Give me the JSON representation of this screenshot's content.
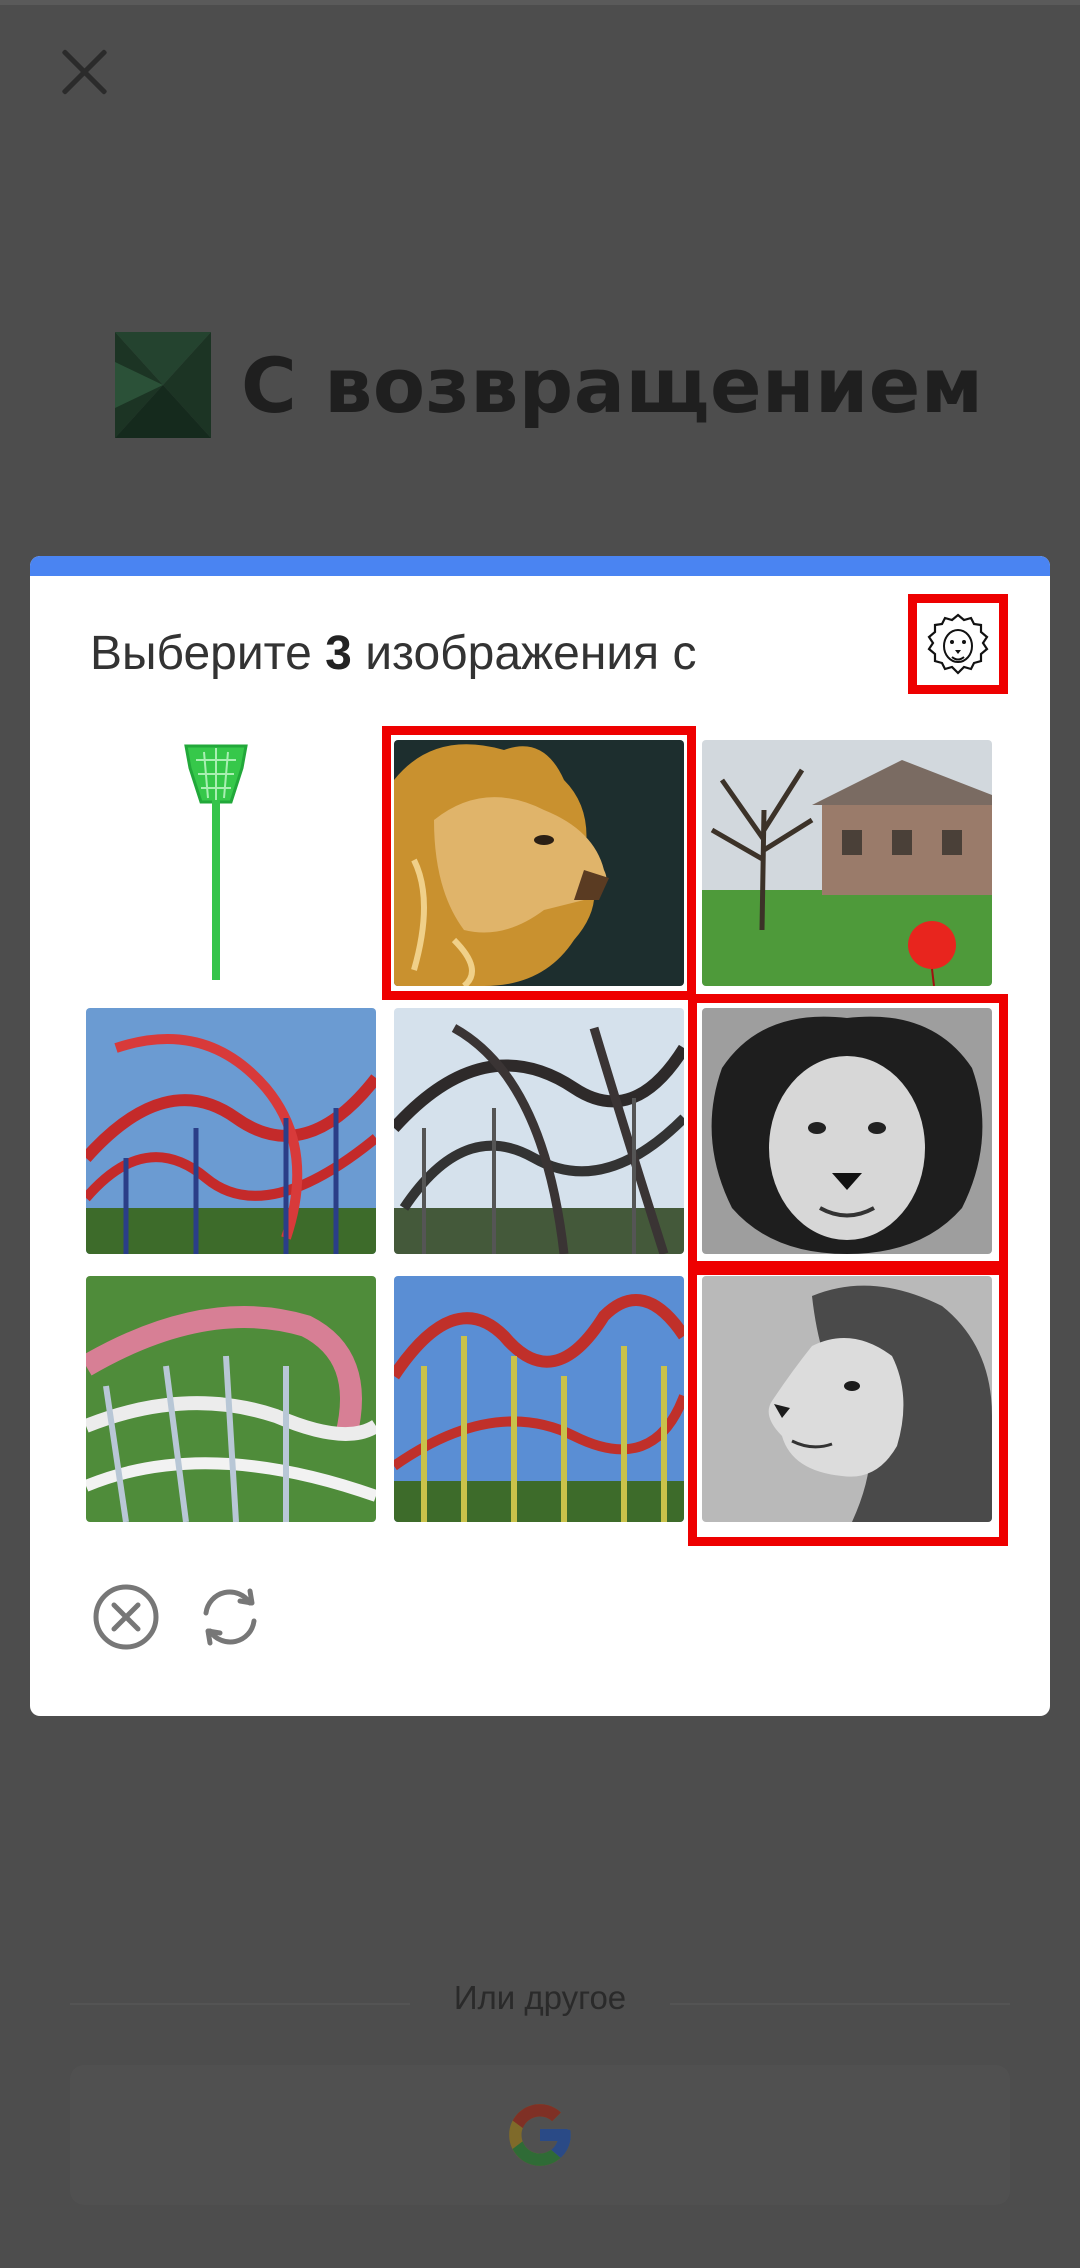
{
  "page": {
    "title": "С возвращением",
    "divider_text": "Или другое"
  },
  "captcha": {
    "prompt_prefix": "Выберите ",
    "prompt_count": "3",
    "prompt_suffix": " изображения с",
    "example_icon": "lion-icon",
    "tiles": [
      {
        "subject": "green fly swatter",
        "selected": false
      },
      {
        "subject": "lion",
        "selected": true
      },
      {
        "subject": "house with red balloon",
        "selected": false
      },
      {
        "subject": "roller coaster",
        "selected": false
      },
      {
        "subject": "roller coaster",
        "selected": false
      },
      {
        "subject": "lion",
        "selected": true
      },
      {
        "subject": "roller coaster",
        "selected": false
      },
      {
        "subject": "roller coaster",
        "selected": false
      },
      {
        "subject": "lion",
        "selected": true
      }
    ],
    "footer_icons": [
      "cancel-icon",
      "refresh-icon"
    ]
  },
  "colors": {
    "accent": "#4a84f2",
    "selection": "#ee0000",
    "overlay": "#4d4d4d"
  }
}
